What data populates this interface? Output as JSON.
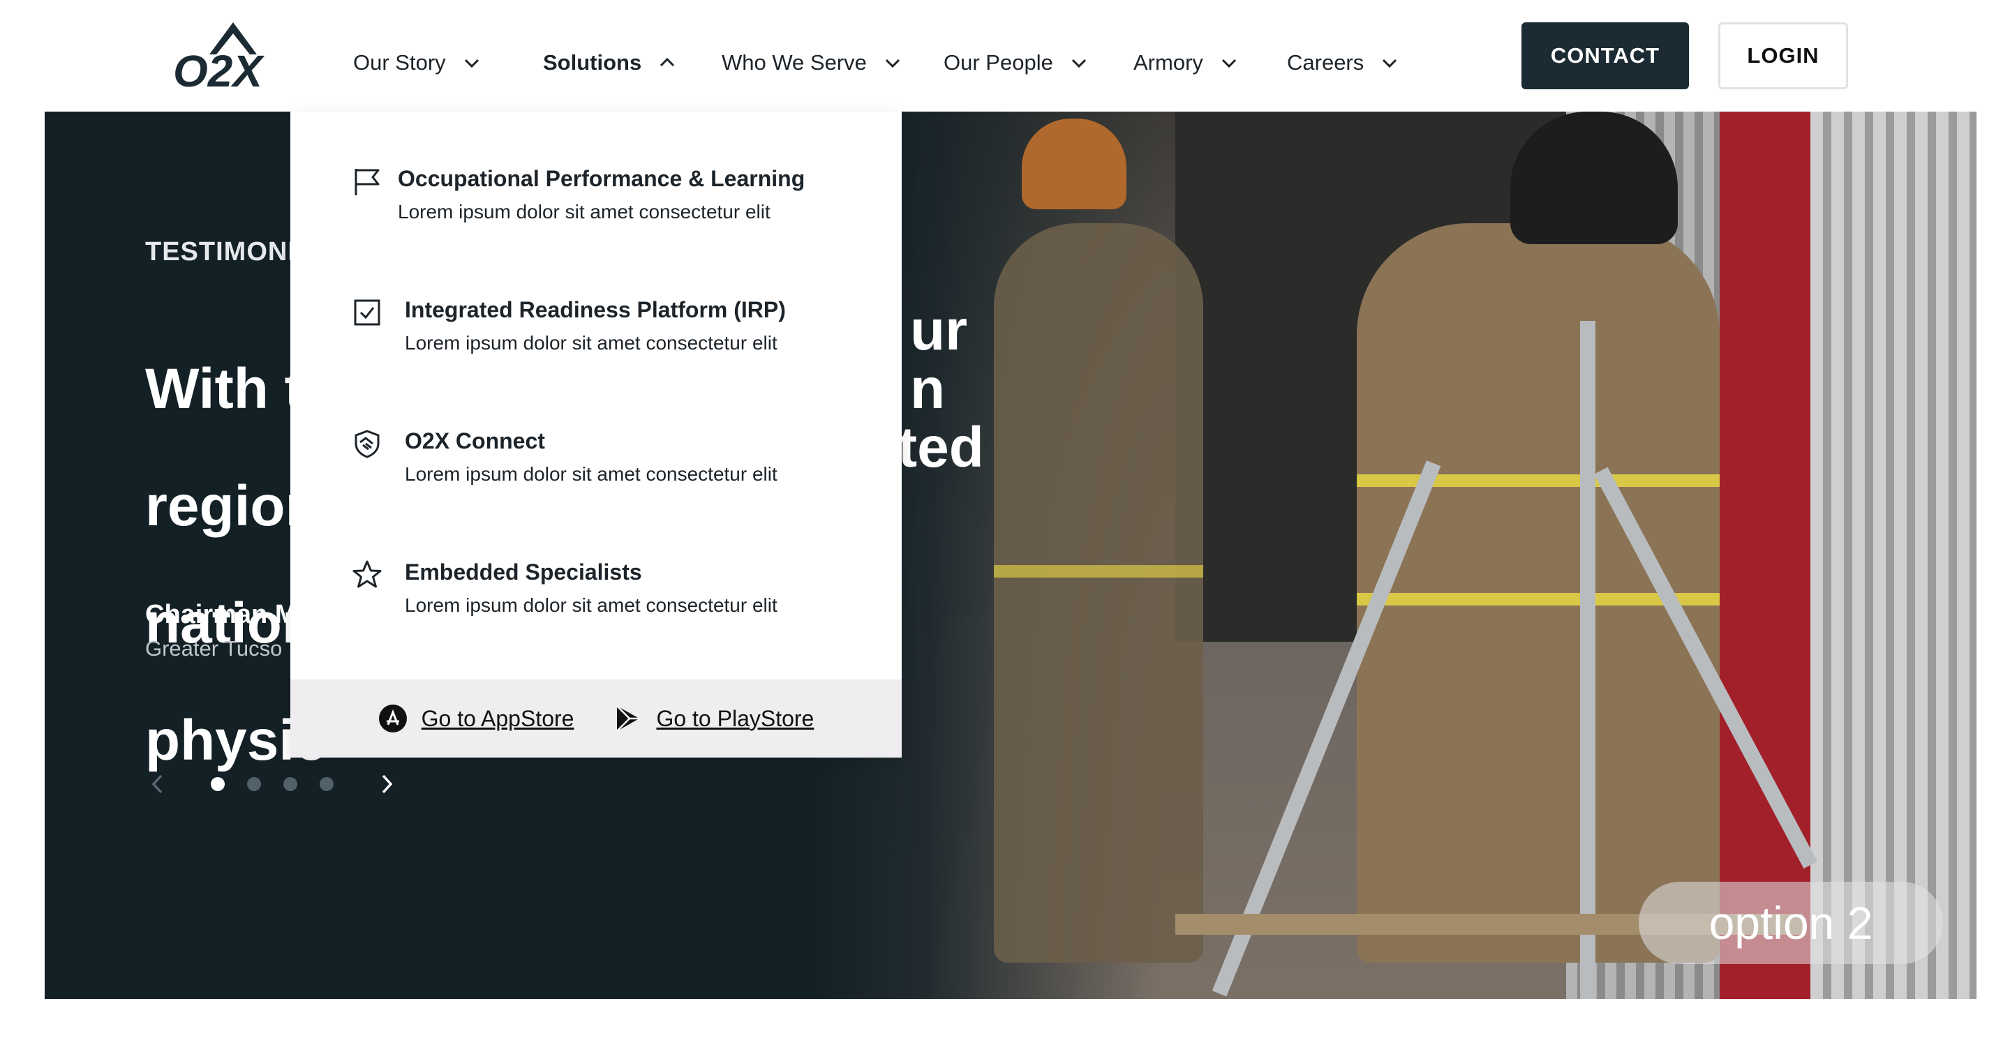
{
  "header": {
    "logo_text": "O2X",
    "nav": [
      {
        "label": "Our Story",
        "active": false
      },
      {
        "label": "Solutions",
        "active": true
      },
      {
        "label": "Who We Serve",
        "active": false
      },
      {
        "label": "Our People",
        "active": false
      },
      {
        "label": "Armory",
        "active": false
      },
      {
        "label": "Careers",
        "active": false
      }
    ],
    "contact_label": "CONTACT",
    "login_label": "LOGIN"
  },
  "dropdown": {
    "items": [
      {
        "title": "Occupational Performance & Learning",
        "desc": "Lorem ipsum dolor sit amet consectetur elit",
        "icon": "flag-icon"
      },
      {
        "title": "Integrated Readiness Platform (IRP)",
        "desc": "Lorem ipsum dolor sit amet consectetur elit",
        "icon": "checkbox-icon"
      },
      {
        "title": "O2X Connect",
        "desc": "Lorem ipsum dolor sit amet consectetur elit",
        "icon": "handshake-icon"
      },
      {
        "title": "Embedded Specialists",
        "desc": "Lorem ipsum dolor sit amet consectetur elit",
        "icon": "star-icon"
      }
    ],
    "appstore_label": "Go to AppStore",
    "playstore_label": "Go to PlayStore"
  },
  "hero": {
    "eyebrow": "TESTIMONI",
    "quote_lines": [
      "With t",
      "regior",
      "natior",
      "physic"
    ],
    "quote_right_lines": [
      "ur",
      "n",
      "ited"
    ],
    "author": "Chairman M",
    "author_location": "Greater Tucso",
    "carousel": {
      "count": 4,
      "active_index": 0
    },
    "option_label": "option 2"
  },
  "colors": {
    "hero_bg": "#132026",
    "contact_bg": "#1c2b33",
    "dropdown_footer_bg": "#efedf0"
  }
}
